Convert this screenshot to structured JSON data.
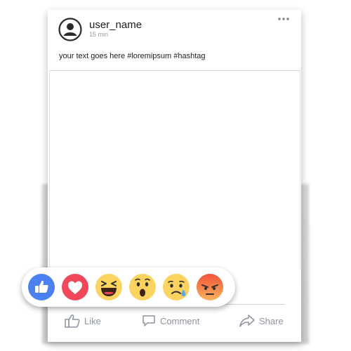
{
  "post": {
    "user_name": "user_name",
    "time": "15 min",
    "text": "your text goes here #loremipsum #hashtag"
  },
  "actions": {
    "like": "Like",
    "comment": "Comment",
    "share": "Share"
  },
  "reactions": [
    "like-icon",
    "love-icon",
    "haha-icon",
    "wow-icon",
    "sad-icon",
    "angry-icon"
  ],
  "colors": {
    "like_blue": "#4a80f0",
    "love_red": "#f0485a",
    "emoji_yellow": "#fbd35e",
    "angry_orange": "#f26a3b",
    "action_gray": "#8d949e"
  }
}
